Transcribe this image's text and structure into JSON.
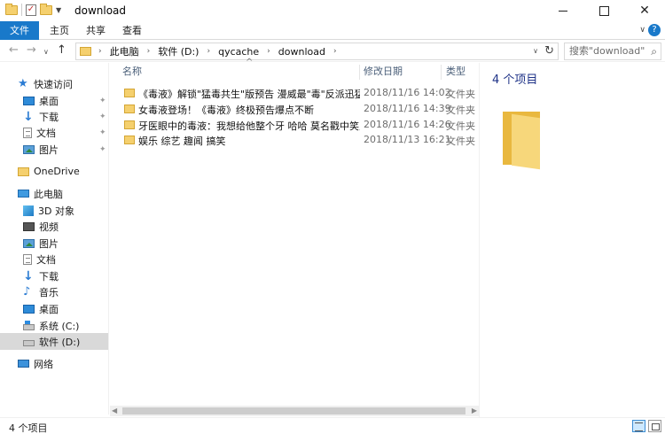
{
  "window": {
    "title": "download",
    "minimize": "",
    "maximize": "",
    "close": "✕"
  },
  "ribbon": {
    "tabs": [
      {
        "label": "文件"
      },
      {
        "label": "主页"
      },
      {
        "label": "共享"
      },
      {
        "label": "查看"
      }
    ],
    "help": "?"
  },
  "navigation": {
    "breadcrumb": [
      "此电脑",
      "软件 (D:)",
      "qycache",
      "download"
    ],
    "search_placeholder": "搜索\"download\""
  },
  "sidebar": {
    "items": [
      {
        "label": "快速访问",
        "icon": "star-icon"
      },
      {
        "label": "桌面",
        "icon": "desktop-icon",
        "pinned": true
      },
      {
        "label": "下载",
        "icon": "download-icon",
        "pinned": true
      },
      {
        "label": "文档",
        "icon": "document-icon",
        "pinned": true
      },
      {
        "label": "图片",
        "icon": "pictures-icon",
        "pinned": true
      },
      {
        "label": "OneDrive",
        "icon": "folder-icon"
      },
      {
        "label": "此电脑",
        "icon": "computer-icon"
      },
      {
        "label": "3D 对象",
        "icon": "3d-objects-icon"
      },
      {
        "label": "视频",
        "icon": "video-icon"
      },
      {
        "label": "图片",
        "icon": "pictures-icon"
      },
      {
        "label": "文档",
        "icon": "document-icon"
      },
      {
        "label": "下载",
        "icon": "download-icon"
      },
      {
        "label": "音乐",
        "icon": "music-icon"
      },
      {
        "label": "桌面",
        "icon": "desktop-icon"
      },
      {
        "label": "系统 (C:)",
        "icon": "system-drive-icon"
      },
      {
        "label": "软件 (D:)",
        "icon": "drive-icon",
        "selected": true
      },
      {
        "label": "网络",
        "icon": "network-icon"
      }
    ]
  },
  "file_list": {
    "columns": {
      "name": "名称",
      "date": "修改日期",
      "type": "类型"
    },
    "rows": [
      {
        "name": "《毒液》解锁\"猛毒共生\"版预告 漫威最\"毒\"反派迅猛来袭",
        "date": "2018/11/16 14:02",
        "type": "文件夹"
      },
      {
        "name": "女毒液登场！《毒液》终极预告爆点不断",
        "date": "2018/11/16 14:39",
        "type": "文件夹"
      },
      {
        "name": "牙医眼中的毒液：我想给他整个牙 哈哈 莫名戳中笑点",
        "date": "2018/11/16 14:26",
        "type": "文件夹"
      },
      {
        "name": "娱乐 综艺 趣闻 搞笑",
        "date": "2018/11/13 16:21",
        "type": "文件夹"
      }
    ]
  },
  "preview": {
    "count_label": "4 个项目"
  },
  "status": {
    "text": "4 个项目"
  },
  "colors": {
    "accent": "#1979ca",
    "selection": "#cce8ff",
    "folder": "#f5d06e"
  }
}
